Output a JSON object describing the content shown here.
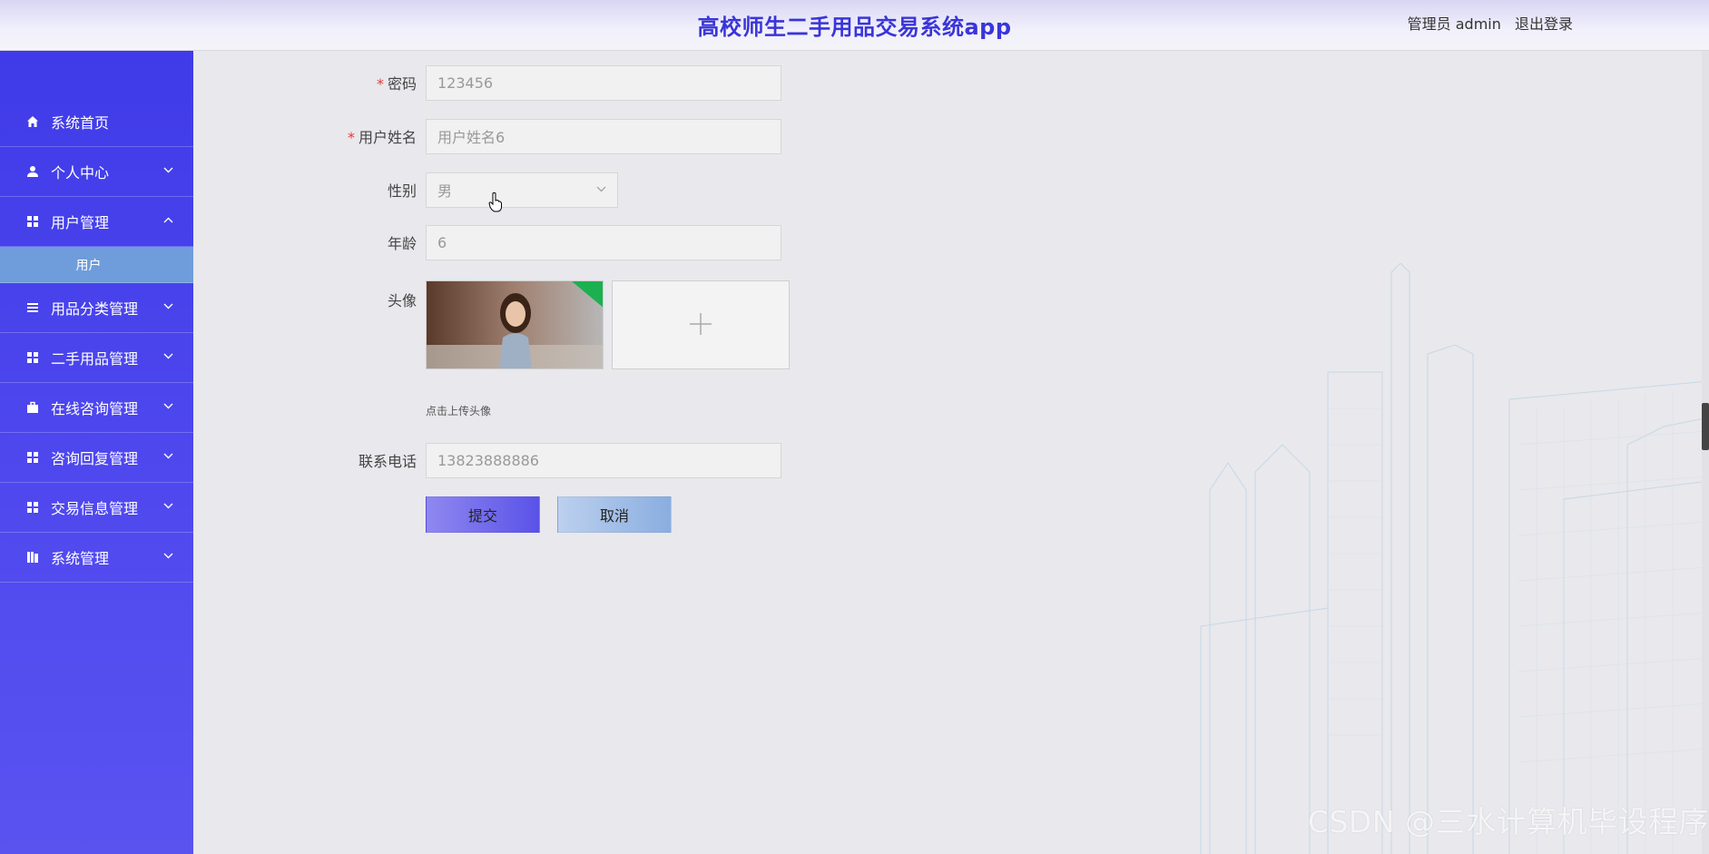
{
  "header": {
    "title": "高校师生二手用品交易系统app",
    "user_label": "管理员 admin",
    "logout_label": "退出登录"
  },
  "sidebar": {
    "items": [
      {
        "label": "系统首页",
        "icon": "home-icon",
        "expandable": false
      },
      {
        "label": "个人中心",
        "icon": "person-icon",
        "expandable": true,
        "expanded": false
      },
      {
        "label": "用户管理",
        "icon": "grid-icon",
        "expandable": true,
        "expanded": true
      },
      {
        "label": "用品分类管理",
        "icon": "list-icon",
        "expandable": true,
        "expanded": false
      },
      {
        "label": "二手用品管理",
        "icon": "grid-icon",
        "expandable": true,
        "expanded": false
      },
      {
        "label": "在线咨询管理",
        "icon": "briefcase-icon",
        "expandable": true,
        "expanded": false
      },
      {
        "label": "咨询回复管理",
        "icon": "grid-icon",
        "expandable": true,
        "expanded": false
      },
      {
        "label": "交易信息管理",
        "icon": "grid-icon",
        "expandable": true,
        "expanded": false
      },
      {
        "label": "系统管理",
        "icon": "book-icon",
        "expandable": true,
        "expanded": false
      }
    ],
    "submenu": {
      "label": "用户"
    }
  },
  "form": {
    "password": {
      "label": "密码",
      "value": "123456",
      "required": true
    },
    "name": {
      "label": "用户姓名",
      "value": "用户姓名6",
      "required": true
    },
    "gender": {
      "label": "性别",
      "value": "男"
    },
    "age": {
      "label": "年龄",
      "value": "6"
    },
    "avatar": {
      "label": "头像",
      "hint": "点击上传头像",
      "upload_icon": "plus-icon"
    },
    "phone": {
      "label": "联系电话",
      "value": "13823888886"
    },
    "submit_label": "提交",
    "cancel_label": "取消"
  },
  "watermark": "CSDN @三水计算机毕设程序",
  "colors": {
    "sidebar": "#4740ec",
    "title": "#3a35d8",
    "submenu": "#6f9ddb",
    "required": "#e4393c"
  }
}
